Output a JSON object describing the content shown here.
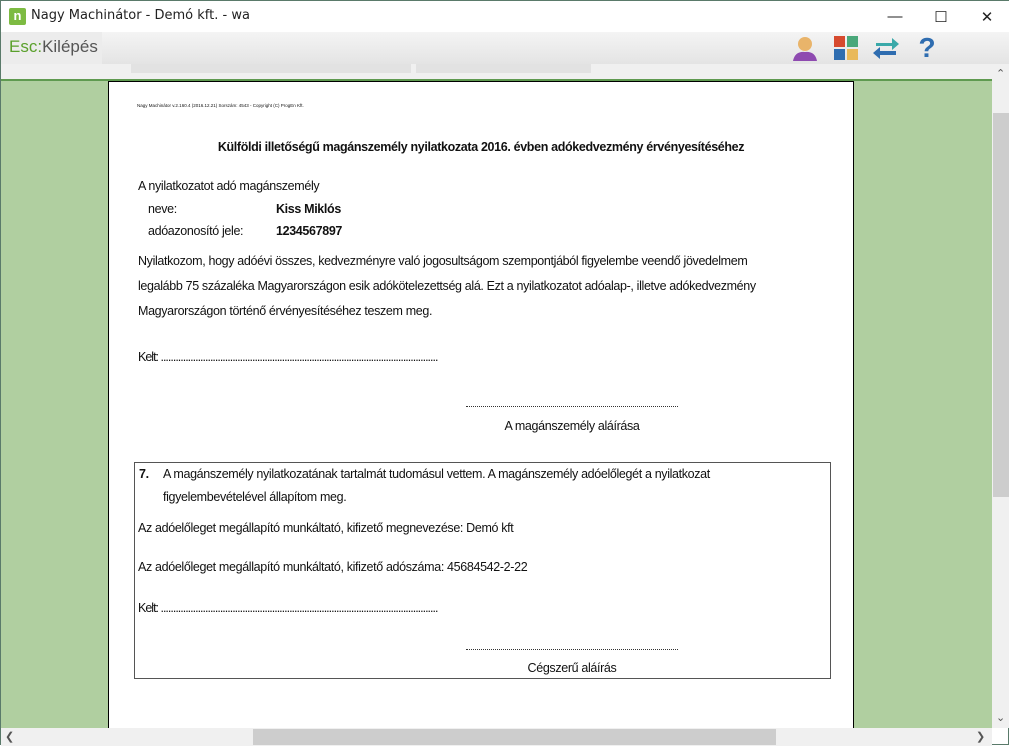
{
  "window": {
    "title": "Nagy Machinátor - Demó kft. - wa",
    "logo": "n"
  },
  "toolbar": {
    "esc_key": "Esc:",
    "esc_label": "Kilépés",
    "icons": [
      "user-icon",
      "modules-icon",
      "switch-icon",
      "help-icon"
    ],
    "help_glyph": "?"
  },
  "document": {
    "header_small": "Nagy Machinátor v.2.160.4 (2016.12.21) Sorszám: 4543 - Copyright (C) ProgEn Kft.",
    "title": "Külföldi illetőségű magánszemély nyilatkozata 2016. évben adókedvezmény érvényesítéséhez",
    "declarant_label": "A nyilatkozatot adó magánszemély",
    "name_label": "neve:",
    "name_value": "Kiss Miklós",
    "taxid_label": "adóazonosító jele:",
    "taxid_value": "1234567897",
    "paragraph": [
      "Nyilatkozom, hogy adóévi összes, kedvezményre való jogosultságom szempontjából figyelembe veendő jövedelmem",
      "legalább 75 százaléka Magyarországon esik adókötelezettség alá. Ezt a nyilatkozatot adóalap-, illetve adókedvezmény",
      "Magyarországon történő érvényesítéséhez teszem meg."
    ],
    "kelt": "Kelt: ................................................................................................................",
    "signature_label": "A magánszemély aláírása",
    "section7": {
      "number": "7.",
      "text": [
        "A magánszemély nyilatkozatának tartalmát tudomásul vettem. A magánszemély adóelőlegét a nyilatkozat",
        "figyelembevételével állapítom meg."
      ],
      "employer_name": "Az adóelőleget megállapító munkáltató, kifizető megnevezése: Demó kft",
      "employer_taxno": "Az adóelőleget megállapító munkáltató, kifizető adószáma: 45684542-2-22",
      "kelt": "Kelt: ................................................................................................................",
      "signature_label": "Cégszerű aláírás"
    }
  },
  "colors": {
    "accent": "#5aa02c",
    "background": "#b0cfa0"
  }
}
